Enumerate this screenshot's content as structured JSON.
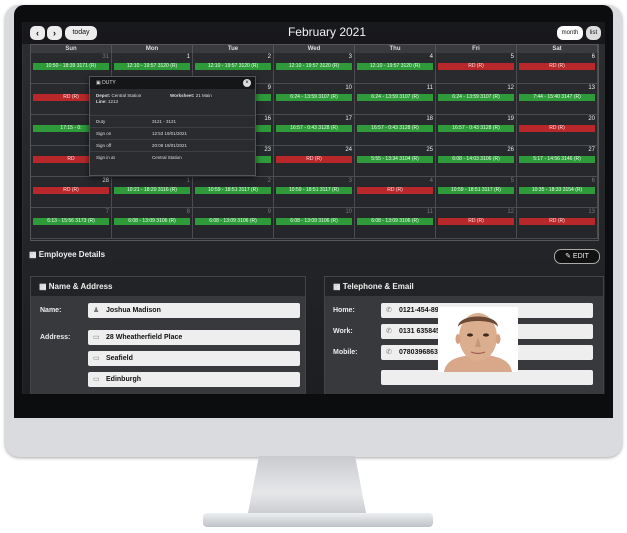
{
  "calendar": {
    "title": "February 2021",
    "nav_prev": "‹",
    "nav_next": "›",
    "today_label": "today",
    "month_label": "month",
    "list_label": "list",
    "days_of_week": [
      "Sun",
      "Mon",
      "Tue",
      "Wed",
      "Thu",
      "Fri",
      "Sat"
    ],
    "weeks": [
      [
        {
          "day": "31",
          "dim": true,
          "event": "10:50 - 18:39 3171 (R)",
          "status": "g"
        },
        {
          "day": "1",
          "dim": false,
          "event": "12:10 - 19:57 3120 (R)",
          "status": "g"
        },
        {
          "day": "2",
          "dim": false,
          "event": "12:10 - 19:57 3120 (R)",
          "status": "g"
        },
        {
          "day": "3",
          "dim": false,
          "event": "12:10 - 19:57 3120 (R)",
          "status": "g"
        },
        {
          "day": "4",
          "dim": false,
          "event": "12:10 - 19:57 3120 (R)",
          "status": "g"
        },
        {
          "day": "5",
          "dim": false,
          "event": "RD (R)",
          "status": "r"
        },
        {
          "day": "6",
          "dim": false,
          "event": "RD (R)",
          "status": "r"
        }
      ],
      [
        {
          "day": "7",
          "dim": false,
          "event": "RD (R)",
          "status": "r"
        },
        {
          "day": "8",
          "dim": false,
          "event": "",
          "status": ""
        },
        {
          "day": "9",
          "dim": false,
          "event": "3107 (R)",
          "status": "g"
        },
        {
          "day": "10",
          "dim": false,
          "event": "6:24 - 13:59 3107 (R)",
          "status": "g"
        },
        {
          "day": "11",
          "dim": false,
          "event": "6:24 - 13:59 3107 (R)",
          "status": "g"
        },
        {
          "day": "12",
          "dim": false,
          "event": "6:24 - 13:59 3107 (R)",
          "status": "g"
        },
        {
          "day": "13",
          "dim": false,
          "event": "7:44 - 15:40 3147 (R)",
          "status": "g"
        }
      ],
      [
        {
          "day": "14",
          "dim": false,
          "event": "17:15 - 0:",
          "status": "g"
        },
        {
          "day": "15",
          "dim": false,
          "event": "",
          "status": ""
        },
        {
          "day": "16",
          "dim": false,
          "event": "3128 (R)",
          "status": "g"
        },
        {
          "day": "17",
          "dim": false,
          "event": "16:57 - 0:43 3128 (R)",
          "status": "g"
        },
        {
          "day": "18",
          "dim": false,
          "event": "16:57 - 0:43 3128 (R)",
          "status": "g"
        },
        {
          "day": "19",
          "dim": false,
          "event": "16:57 - 0:43 3128 (R)",
          "status": "g"
        },
        {
          "day": "20",
          "dim": false,
          "event": "RD (R)",
          "status": "r"
        }
      ],
      [
        {
          "day": "21",
          "dim": false,
          "event": "RD",
          "status": "r"
        },
        {
          "day": "22",
          "dim": false,
          "event": "",
          "status": ""
        },
        {
          "day": "23",
          "dim": false,
          "event": "3109 (R)",
          "status": "g"
        },
        {
          "day": "24",
          "dim": false,
          "event": "RD (R)",
          "status": "r"
        },
        {
          "day": "25",
          "dim": false,
          "event": "5:55 - 13:34 3104 (R)",
          "status": "g"
        },
        {
          "day": "26",
          "dim": false,
          "event": "6:08 - 14:03 3106 (R)",
          "status": "g"
        },
        {
          "day": "27",
          "dim": false,
          "event": "5:17 - 14:56 3146 (R)",
          "status": "g"
        }
      ],
      [
        {
          "day": "28",
          "dim": false,
          "event": "RD (R)",
          "status": "r"
        },
        {
          "day": "1",
          "dim": true,
          "event": "10:21 - 18:20 3116 (R)",
          "status": "g"
        },
        {
          "day": "2",
          "dim": true,
          "event": "10:59 - 18:51 3117 (R)",
          "status": "g"
        },
        {
          "day": "3",
          "dim": true,
          "event": "10:59 - 18:51 3117 (R)",
          "status": "g"
        },
        {
          "day": "4",
          "dim": true,
          "event": "RD (R)",
          "status": "r"
        },
        {
          "day": "5",
          "dim": true,
          "event": "10:59 - 18:51 3117 (R)",
          "status": "g"
        },
        {
          "day": "6",
          "dim": true,
          "event": "10:35 - 18:33 3154 (R)",
          "status": "g"
        }
      ],
      [
        {
          "day": "7",
          "dim": true,
          "event": "6:13 - 15:56 3173 (R)",
          "status": "g"
        },
        {
          "day": "8",
          "dim": true,
          "event": "6:08 - 13:09 3106 (R)",
          "status": "g"
        },
        {
          "day": "9",
          "dim": true,
          "event": "6:08 - 13:09 3106 (R)",
          "status": "g"
        },
        {
          "day": "10",
          "dim": true,
          "event": "6:08 - 13:09 3106 (R)",
          "status": "g"
        },
        {
          "day": "11",
          "dim": true,
          "event": "6:08 - 13:09 3106 (R)",
          "status": "g"
        },
        {
          "day": "12",
          "dim": true,
          "event": "RD (R)",
          "status": "r"
        },
        {
          "day": "13",
          "dim": true,
          "event": "RD (R)",
          "status": "r"
        }
      ]
    ]
  },
  "duty_popup": {
    "title": "DUTY",
    "close": "×",
    "depot_label": "Depot:",
    "depot_value": "Central Station",
    "line_label": "Line:",
    "line_value": "1213",
    "worksheet_label": "Worksheet:",
    "worksheet_value": "21 Main",
    "rows": [
      {
        "label": "Duty",
        "value": "3121 - 3121"
      },
      {
        "label": "Sign on",
        "value": "12:53 19/01/2021"
      },
      {
        "label": "Sign off",
        "value": "20:08 19/01/2021"
      },
      {
        "label": "Sign in at",
        "value": "Central Station"
      }
    ]
  },
  "employee": {
    "section_title": "Employee Details",
    "edit_label": "EDIT",
    "name_address": {
      "title": "Name & Address",
      "name_label": "Name:",
      "name_value": "Joshua Madison",
      "address_label": "Address:",
      "address_lines": [
        "28 Wheatherfield Place",
        "Seafield",
        "Edinburgh"
      ]
    },
    "telephone": {
      "title": "Telephone & Email",
      "home_label": "Home:",
      "home_value": "0121-454-8971",
      "work_label": "Work:",
      "work_value": "0131 635845",
      "mobile_label": "Mobile:",
      "mobile_value": "07803968633"
    }
  },
  "colors": {
    "on_duty": "#2e9a3a",
    "rest_day": "#b8282b",
    "background": "#1f2125"
  }
}
